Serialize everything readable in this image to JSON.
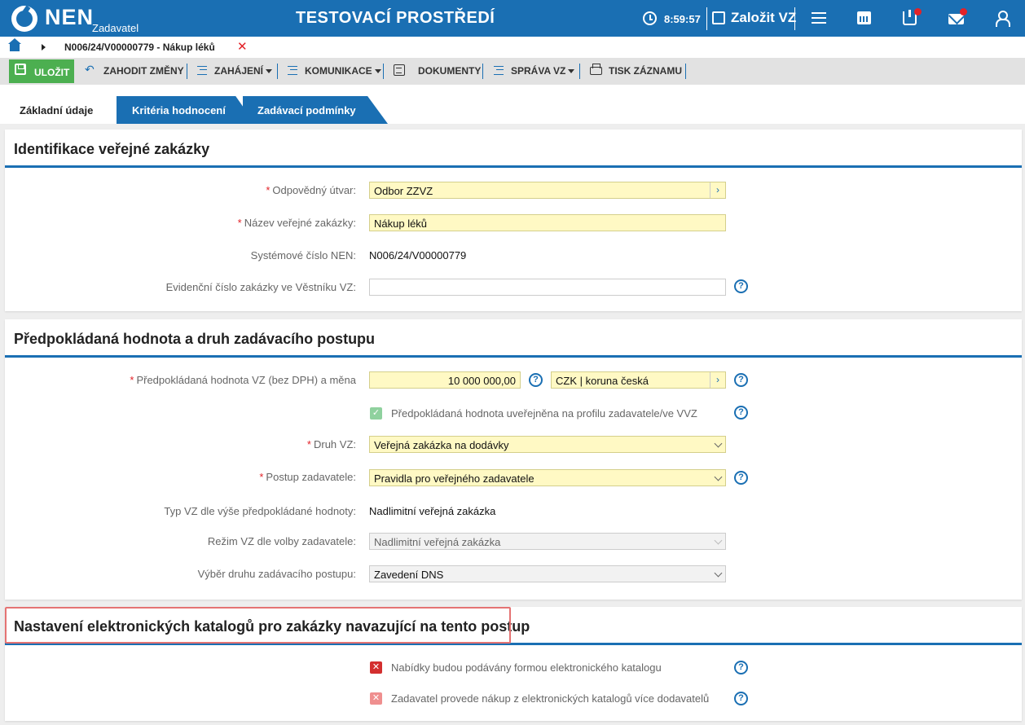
{
  "header": {
    "logo": "NEN",
    "logo_sub": "Zadavatel",
    "env_title": "TESTOVACÍ PROSTŘEDÍ",
    "time": "8:59:57",
    "create_label": "Založit VZ"
  },
  "breadcrumb": {
    "text": "N006/24/V00000779 - Nákup léků"
  },
  "toolbar": {
    "save": "ULOŽIT",
    "discard": "ZAHODIT ZMĚNY",
    "start": "ZAHÁJENÍ",
    "communication": "KOMUNIKACE",
    "documents": "DOKUMENTY",
    "admin": "SPRÁVA VZ",
    "print": "TISK ZÁZNAMU"
  },
  "tabs": [
    {
      "label": "Základní údaje",
      "active": true
    },
    {
      "label": "Kritéria hodnocení"
    },
    {
      "label": "Zadávací podmínky"
    }
  ],
  "section1": {
    "title": "Identifikace veřejné zakázky",
    "unit_label": "Odpovědný útvar:",
    "unit_value": "Odbor ZZVZ",
    "name_label": "Název veřejné zakázky:",
    "name_value": "Nákup léků",
    "sysnum_label": "Systémové číslo NEN:",
    "sysnum_value": "N006/24/V00000779",
    "evnum_label": "Evidenční číslo zakázky ve Věstníku VZ:",
    "evnum_value": ""
  },
  "section2": {
    "title": "Předpokládaná hodnota a druh zadávacího postupu",
    "value_label": "Předpokládaná hodnota VZ (bez DPH) a měna",
    "value_amount": "10 000 000,00",
    "currency": "CZK | koruna česká",
    "published_label": "Předpokládaná hodnota uveřejněna na profilu zadavatele/ve VVZ",
    "published_checked": true,
    "kind_label": "Druh VZ:",
    "kind_value": "Veřejná zakázka na dodávky",
    "procedure_label": "Postup zadavatele:",
    "procedure_value": "Pravidla pro veřejného zadavatele",
    "type_label": "Typ VZ dle výše předpokládané hodnoty:",
    "type_value": "Nadlimitní veřejná zakázka",
    "mode_label": "Režim VZ dle volby zadavatele:",
    "mode_value": "Nadlimitní veřejná zakázka",
    "select_label": "Výběr druhu zadávacího postupu:",
    "select_value": "Zavedení DNS"
  },
  "section3": {
    "title": "Nastavení elektronických katalogů pro zakázky navazující na tento postup",
    "opt1": "Nabídky budou podávány formou elektronického katalogu",
    "opt2": "Zadavatel provede nákup z elektronických katalogů více dodavatelů"
  },
  "colors": {
    "brand": "#1a6fb3",
    "save": "#4caf50",
    "required": "#e32228"
  }
}
